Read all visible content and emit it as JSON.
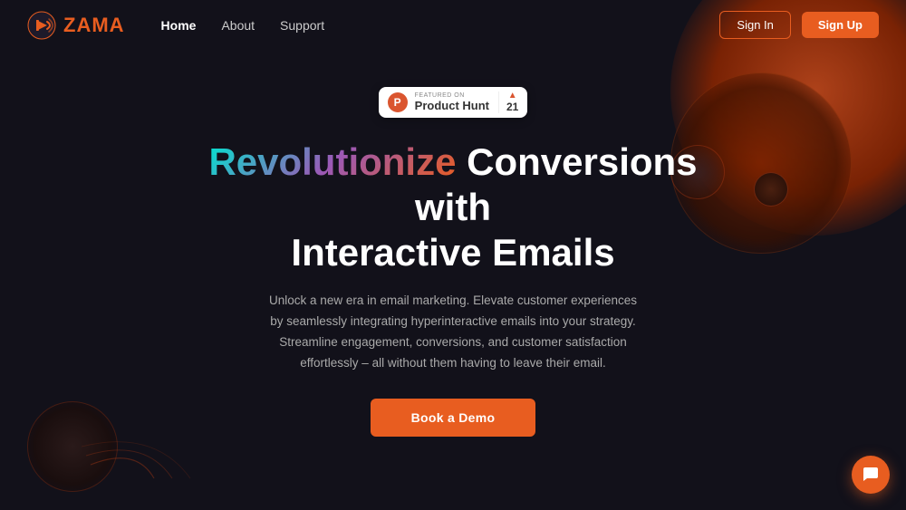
{
  "brand": {
    "logo_text": "ZAMA",
    "logo_icon": "megaphone"
  },
  "nav": {
    "links": [
      {
        "label": "Home",
        "active": true
      },
      {
        "label": "About",
        "active": false
      },
      {
        "label": "Support",
        "active": false
      }
    ],
    "signin_label": "Sign In",
    "signup_label": "Sign Up"
  },
  "product_hunt": {
    "featured_on": "FEATURED ON",
    "name": "Product Hunt",
    "vote_count": "21"
  },
  "hero": {
    "title_gradient": "Revolutionize",
    "title_rest_line1": " Conversions with",
    "title_line2": "Interactive Emails",
    "subtitle": "Unlock a new era in email marketing. Elevate customer experiences by seamlessly integrating hyperinteractive emails into your strategy. Streamline engagement, conversions, and customer satisfaction effortlessly – all without them having to leave their email.",
    "cta_label": "Book a Demo"
  },
  "chat": {
    "icon": "chat"
  }
}
